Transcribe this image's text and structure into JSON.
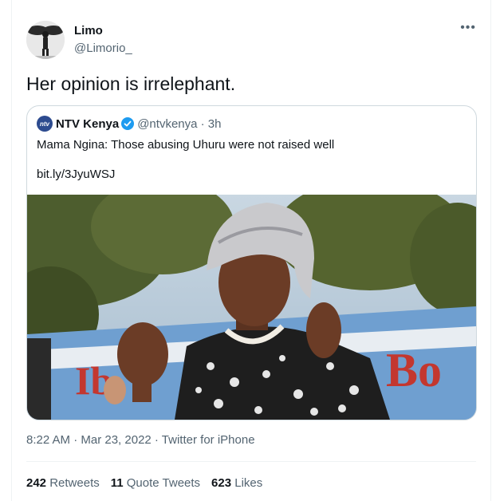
{
  "tweet": {
    "author_name": "Limo",
    "author_handle": "@Limorio_",
    "more_icon": "more-horizontal-icon",
    "text": "Her opinion is irrelephant.",
    "timestamp": "8:22 AM · Mar 23, 2022 · Twitter for iPhone"
  },
  "quote": {
    "logo_text": "ntv",
    "author_name": "NTV Kenya",
    "author_handle": "@ntvkenya · 3h",
    "text": "Mama Ngina: Those abusing Uhuru were not raised well",
    "link": "bit.ly/3JyuWSJ"
  },
  "stats": {
    "retweets_count": "242",
    "retweets_label": "Retweets",
    "quotes_count": "11",
    "quotes_label": "Quote Tweets",
    "likes_count": "623",
    "likes_label": "Likes"
  },
  "colors": {
    "text": "#0f1419",
    "secondary": "#536471",
    "verified": "#1d9bf0",
    "border": "#cfd9de",
    "ntv_blue": "#2d4b8f"
  }
}
